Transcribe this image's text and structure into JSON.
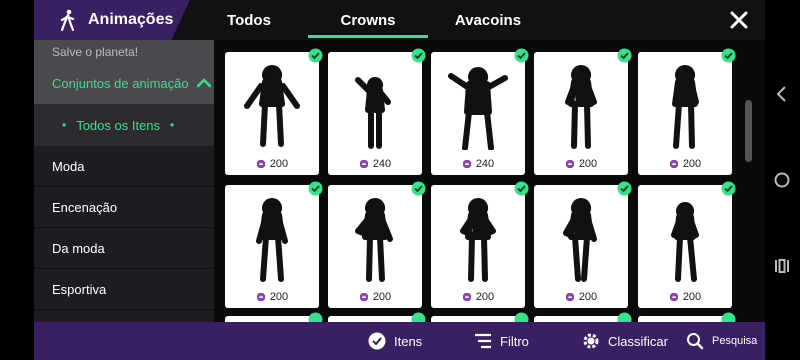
{
  "header": {
    "app_title": "Animações",
    "tabs": [
      {
        "label": "Todos"
      },
      {
        "label": "Crowns"
      },
      {
        "label": "Avacoins"
      }
    ],
    "active_tab": "Crowns"
  },
  "sidebar": {
    "top_item": "Salve o planeta!",
    "group": "Conjuntos de animação",
    "sub_item": "Todos os Itens",
    "items": [
      {
        "label": "Moda"
      },
      {
        "label": "Encenação"
      },
      {
        "label": "Da moda"
      },
      {
        "label": "Esportiva"
      }
    ]
  },
  "grid": {
    "cards": [
      {
        "price": "200",
        "owned": true
      },
      {
        "price": "240",
        "owned": true
      },
      {
        "price": "240",
        "owned": true
      },
      {
        "price": "200",
        "owned": true
      },
      {
        "price": "200",
        "owned": true
      },
      {
        "price": "200",
        "owned": true
      },
      {
        "price": "200",
        "owned": true
      },
      {
        "price": "200",
        "owned": true
      },
      {
        "price": "200",
        "owned": true
      },
      {
        "price": "200",
        "owned": true
      }
    ]
  },
  "bottombar": {
    "itens": "Itens",
    "filtro": "Filtro",
    "classificar": "Classificar",
    "pesquisa": "Pesquisa"
  },
  "colors": {
    "accent": "#37e08b",
    "brand_purple": "#3a1f63",
    "gem_purple": "#8e44ad"
  }
}
